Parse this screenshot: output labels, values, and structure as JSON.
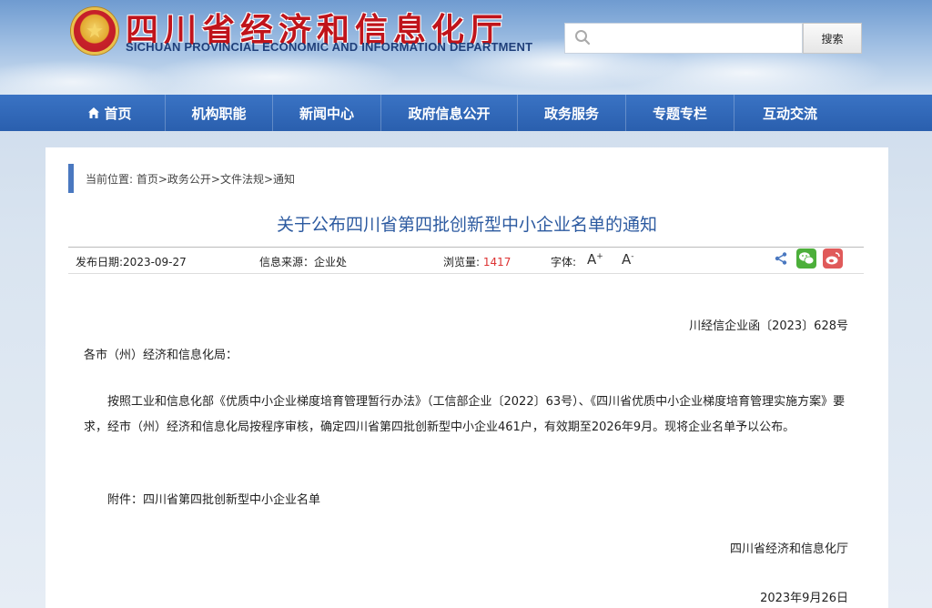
{
  "header": {
    "title": "四川省经济和信息化厅",
    "subtitle": "SICHUAN PROVINCIAL ECONOMIC AND INFORMATION DEPARTMENT",
    "emblem_icon": "national-emblem-icon",
    "search": {
      "placeholder": "",
      "value": "",
      "button_label": "搜索",
      "icon": "search-icon"
    }
  },
  "nav": {
    "items": [
      {
        "label": "首页",
        "icon": "home-icon"
      },
      {
        "label": "机构职能"
      },
      {
        "label": "新闻中心"
      },
      {
        "label": "政府信息公开"
      },
      {
        "label": "政务服务"
      },
      {
        "label": "专题专栏"
      },
      {
        "label": "互动交流"
      }
    ]
  },
  "article": {
    "breadcrumb": "当前位置: 首页>政务公开>文件法规>通知",
    "title": "关于公布四川省第四批创新型中小企业名单的通知",
    "meta": {
      "publish_date": "发布日期:2023-09-27",
      "source": "信息来源：企业处",
      "views_label": "浏览量:",
      "views_value": "1417",
      "font_label": "字体:",
      "font_increase": "A",
      "font_increase_sup": "+",
      "font_decrease": "A",
      "font_decrease_sup": "-"
    },
    "doc_number": "川经信企业函〔2023〕628号",
    "addressee": "各市（州）经济和信息化局：",
    "body": "按照工业和信息化部《优质中小企业梯度培育管理暂行办法》（工信部企业〔2022〕63号）、《四川省优质中小企业梯度培育管理实施方案》要求，经市（州）经济和信息化局按程序审核，确定四川省第四批创新型中小企业461户，有效期至2026年9月。现将企业名单予以公布。",
    "attachment": "附件：四川省第四批创新型中小企业名单",
    "signature": "四川省经济和信息化厅",
    "sign_date": "2023年9月26日"
  },
  "colors": {
    "nav_bg": "#2f66b8",
    "title_color": "#2c5aa0",
    "header_title_red": "#c0141b",
    "views_red": "#dd3333",
    "wechat_green": "#4caf3a",
    "weibo_red": "#e05a5a"
  }
}
